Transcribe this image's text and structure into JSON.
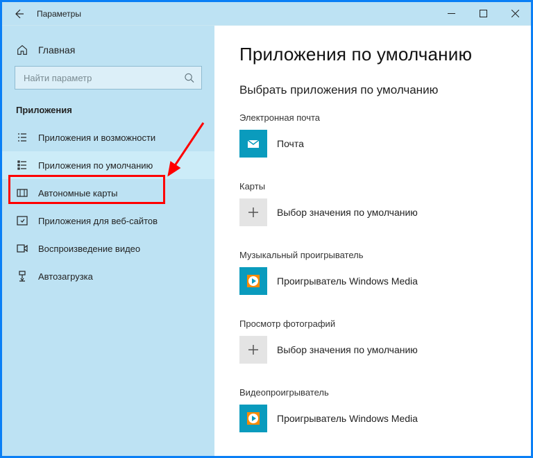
{
  "window": {
    "title": "Параметры"
  },
  "sidebar": {
    "home_label": "Главная",
    "search_placeholder": "Найти параметр",
    "section_label": "Приложения",
    "items": [
      {
        "icon": "list-icon",
        "label": "Приложения и возможности"
      },
      {
        "icon": "defaults-icon",
        "label": "Приложения по умолчанию"
      },
      {
        "icon": "map-icon",
        "label": "Автономные карты"
      },
      {
        "icon": "website-icon",
        "label": "Приложения для веб-сайтов"
      },
      {
        "icon": "video-icon",
        "label": "Воспроизведение видео"
      },
      {
        "icon": "startup-icon",
        "label": "Автозагрузка"
      }
    ],
    "active_index": 1
  },
  "main": {
    "heading": "Приложения по умолчанию",
    "subheading": "Выбрать приложения по умолчанию",
    "groups": [
      {
        "label": "Электронная почта",
        "app": "Почта",
        "tile": "mail"
      },
      {
        "label": "Карты",
        "app": "Выбор значения по умолчанию",
        "tile": "plus"
      },
      {
        "label": "Музыкальный проигрыватель",
        "app": "Проигрыватель Windows Media",
        "tile": "wmp"
      },
      {
        "label": "Просмотр фотографий",
        "app": "Выбор значения по умолчанию",
        "tile": "plus"
      },
      {
        "label": "Видеопроигрыватель",
        "app": "Проигрыватель Windows Media",
        "tile": "wmp"
      }
    ]
  },
  "annotation": {
    "highlighted_item_index": 1
  }
}
